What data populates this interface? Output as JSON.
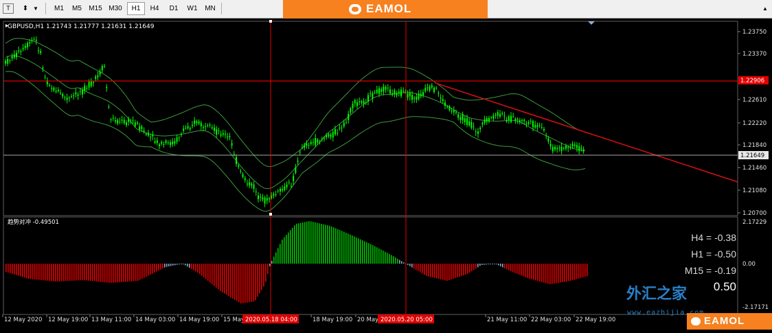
{
  "toolbar": {
    "timeframes": [
      "M1",
      "M5",
      "M15",
      "M30",
      "H1",
      "H4",
      "D1",
      "W1",
      "MN"
    ],
    "active": "H1"
  },
  "banner": {
    "brand": "EAMOL"
  },
  "chart": {
    "symbol_info": "GBPUSD,H1  1.21743 1.21777 1.21631 1.21649",
    "price_axis": [
      "1.23750",
      "1.23370",
      "1.22990",
      "1.22610",
      "1.22220",
      "1.21840",
      "1.21460",
      "1.21080",
      "1.20700"
    ],
    "current_price": "1.21649",
    "line_price": "1.22906",
    "time_axis": [
      "12 May 2020",
      "12 May 19:00",
      "13 May 11:00",
      "14 May 03:00",
      "14 May 19:00",
      "15 May 11:00",
      "18 May 19:00",
      "20 May 19:00",
      "21 May 11:00",
      "22 May 03:00",
      "22 May 19:00"
    ],
    "crosshair_labels": [
      "2020.05.18 04:00",
      "2020.05.20 05:00"
    ]
  },
  "indicator": {
    "title": "趋势对冲 -0.49501",
    "axis": [
      "2.17229",
      "0.00",
      "-2.17171"
    ],
    "values": [
      "H4 = -0.38",
      "H1 = -0.50",
      "M15 = -0.19",
      "0.50"
    ]
  },
  "watermark": {
    "cn": "外汇之家",
    "url": "www.eazhijia.com"
  },
  "footer_logo": "EAMOL",
  "colors": {
    "candle": "#00ff00",
    "bands": "#3c9a3c",
    "red": "#ff0000",
    "hist_up": "#00c000",
    "hist_down": "#e00000",
    "hist_neutral": "#8aa8c8"
  }
}
